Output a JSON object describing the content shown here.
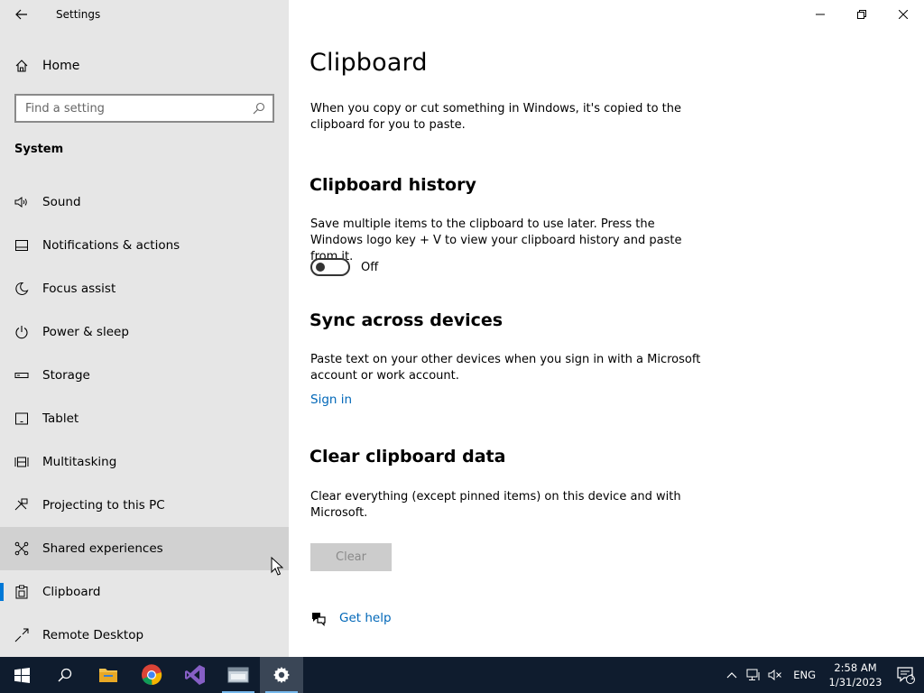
{
  "window": {
    "title": "Settings"
  },
  "sidebar": {
    "home_label": "Home",
    "search_placeholder": "Find a setting",
    "section": "System",
    "items": [
      {
        "label": "Sound",
        "icon": "speaker-icon"
      },
      {
        "label": "Notifications & actions",
        "icon": "notification-icon"
      },
      {
        "label": "Focus assist",
        "icon": "moon-icon"
      },
      {
        "label": "Power & sleep",
        "icon": "power-icon"
      },
      {
        "label": "Storage",
        "icon": "storage-icon"
      },
      {
        "label": "Tablet",
        "icon": "tablet-icon"
      },
      {
        "label": "Multitasking",
        "icon": "multitasking-icon"
      },
      {
        "label": "Projecting to this PC",
        "icon": "projecting-icon"
      },
      {
        "label": "Shared experiences",
        "icon": "shared-experiences-icon"
      },
      {
        "label": "Clipboard",
        "icon": "clipboard-icon"
      },
      {
        "label": "Remote Desktop",
        "icon": "remote-desktop-icon"
      }
    ],
    "selected": "Clipboard",
    "hovered": "Shared experiences"
  },
  "main": {
    "title": "Clipboard",
    "intro": "When you copy or cut something in Windows, it's copied to the clipboard for you to paste.",
    "history": {
      "heading": "Clipboard history",
      "description": "Save multiple items to the clipboard to use later. Press the Windows logo key + V to view your clipboard history and paste from it.",
      "toggle_state": "Off"
    },
    "sync": {
      "heading": "Sync across devices",
      "description": "Paste text on your other devices when you sign in with a Microsoft account or work account.",
      "link": "Sign in"
    },
    "clear": {
      "heading": "Clear clipboard data",
      "description": "Clear everything (except pinned items) on this device and with Microsoft.",
      "button": "Clear"
    },
    "help_link": "Get help"
  },
  "taskbar": {
    "apps": [
      {
        "name": "start-button",
        "icon": "windows-logo-icon"
      },
      {
        "name": "search-button",
        "icon": "search-icon"
      },
      {
        "name": "file-explorer",
        "icon": "folder-icon"
      },
      {
        "name": "chrome",
        "icon": "chrome-icon"
      },
      {
        "name": "visual-studio",
        "icon": "visual-studio-icon"
      },
      {
        "name": "app-window",
        "icon": "app-icon"
      },
      {
        "name": "settings",
        "icon": "gear-icon"
      }
    ],
    "language": "ENG",
    "time": "2:58 AM",
    "date": "1/31/2023",
    "notification_count": "1"
  },
  "colors": {
    "sidebar_bg": "#e6e6e6",
    "accent": "#0078d7",
    "link": "#0067b8",
    "taskbar_bg": "#0f1c2e"
  }
}
